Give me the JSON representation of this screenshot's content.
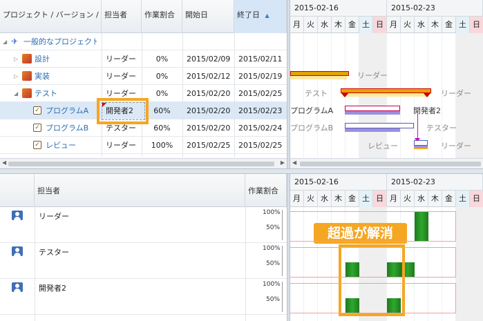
{
  "colors": {
    "accent": "#f5a623",
    "bar_green": "#2a9a2a",
    "header_sort": "#d7e6f7",
    "selected_row": "#dbe9f7"
  },
  "task_grid": {
    "headers": {
      "name": "プロジェクト / バージョン / …",
      "assignee": "担当者",
      "ratio": "作業割合",
      "start": "開始日",
      "end": "終了日"
    },
    "rows": [
      {
        "name": "一般的なプロジェクト",
        "assignee": "",
        "ratio": "",
        "start": "",
        "end": "",
        "icon": "project-icon"
      },
      {
        "name": "設計",
        "assignee": "リーダー",
        "ratio": "0%",
        "start": "2015/02/09",
        "end": "2015/02/11",
        "icon": "version-icon"
      },
      {
        "name": "実装",
        "assignee": "リーダー",
        "ratio": "0%",
        "start": "2015/02/12",
        "end": "2015/02/19",
        "icon": "version-icon"
      },
      {
        "name": "テスト",
        "assignee": "リーダー",
        "ratio": "0%",
        "start": "2015/02/20",
        "end": "2015/02/25",
        "icon": "version-icon"
      },
      {
        "name": "プログラムA",
        "assignee": "開発者2",
        "ratio": "60%",
        "start": "2015/02/20",
        "end": "2015/02/23",
        "icon": "issue-icon"
      },
      {
        "name": "プログラムB",
        "assignee": "テスター",
        "ratio": "60%",
        "start": "2015/02/20",
        "end": "2015/02/24",
        "icon": "issue-icon"
      },
      {
        "name": "レビュー",
        "assignee": "リーダー",
        "ratio": "100%",
        "start": "2015/02/25",
        "end": "2015/02/25",
        "icon": "issue-icon"
      }
    ]
  },
  "timeline": {
    "weeks": [
      "2015-02-16",
      "2015-02-23"
    ],
    "days": [
      "月",
      "火",
      "水",
      "木",
      "金",
      "土",
      "日",
      "月",
      "火",
      "水",
      "木",
      "金",
      "土",
      "日"
    ]
  },
  "gantt_labels": {
    "impl_assignee": "リーダー",
    "test_name": "テスト",
    "test_assignee": "リーダー",
    "progA_name": "プログラムA",
    "progA_assignee": "開発者2",
    "progB_name": "プログラムB",
    "progB_assignee": "テスター",
    "review_name": "レビュー",
    "review_assignee": "リーダー"
  },
  "resource_grid": {
    "headers": {
      "assignee": "担当者",
      "ratio": "作業割合"
    },
    "rows": [
      {
        "name": "リーダー",
        "tick_top": "100%",
        "tick_mid": "50%"
      },
      {
        "name": "テスター",
        "tick_top": "100%",
        "tick_mid": "50%"
      },
      {
        "name": "開発者2",
        "tick_top": "100%",
        "tick_mid": "50%"
      }
    ]
  },
  "resource_load": [
    {
      "name": "リーダー",
      "days": [
        0,
        0,
        0,
        0,
        0,
        0,
        0,
        0,
        0,
        1,
        0,
        0,
        0,
        0
      ]
    },
    {
      "name": "テスター",
      "days": [
        0,
        0,
        0,
        0,
        0.5,
        0,
        0,
        0.5,
        0.5,
        0,
        0,
        0,
        0,
        0
      ]
    },
    {
      "name": "開発者2",
      "days": [
        0,
        0,
        0,
        0,
        0.5,
        0,
        0,
        0.5,
        0,
        0,
        0,
        0,
        0,
        0
      ]
    }
  ],
  "callout": {
    "text": "超過が解消"
  }
}
